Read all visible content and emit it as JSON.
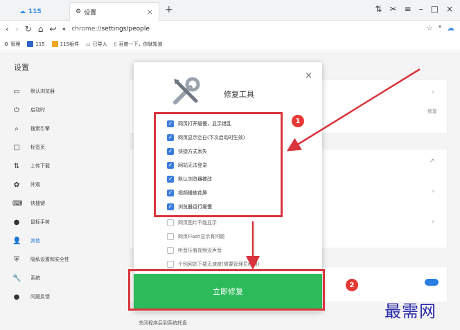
{
  "tabs": [
    {
      "label": "115"
    },
    {
      "label": "设置"
    }
  ],
  "nav": {
    "url_scheme": "chrome://",
    "url_rest": "settings/people"
  },
  "bookmarks": [
    {
      "label": "管理"
    },
    {
      "label": "115"
    },
    {
      "label": "115组件"
    },
    {
      "label": "已导入"
    },
    {
      "label": "百度一下，你就知道"
    }
  ],
  "sidebar": {
    "title": "设置",
    "items": [
      {
        "label": "默认浏览器",
        "icon": "browser-icon"
      },
      {
        "label": "启动时",
        "icon": "power-icon"
      },
      {
        "label": "搜索引擎",
        "icon": "search-icon"
      },
      {
        "label": "标签页",
        "icon": "tab-icon"
      },
      {
        "label": "上传下载",
        "icon": "transfer-icon"
      },
      {
        "label": "外观",
        "icon": "palette-icon"
      },
      {
        "label": "快捷键",
        "icon": "keyboard-icon"
      },
      {
        "label": "鼠标手势",
        "icon": "mouse-icon"
      },
      {
        "label": "其他",
        "icon": "person-icon"
      },
      {
        "label": "隐私设置和安全性",
        "icon": "shield-icon"
      },
      {
        "label": "系统",
        "icon": "wrench-icon"
      },
      {
        "label": "问题反馈",
        "icon": "feedback-icon"
      }
    ]
  },
  "content": {
    "repair_link": "修复",
    "bottom_text": "关闭程序后到系统托盘"
  },
  "dialog": {
    "title": "修复工具",
    "options": [
      {
        "label": "网页打开缓慢，显示错乱",
        "checked": true
      },
      {
        "label": "网页显示空白(下次启动时生效)",
        "checked": true
      },
      {
        "label": "快捷方式丢失",
        "checked": true
      },
      {
        "label": "网站无法登录",
        "checked": true
      },
      {
        "label": "默认浏览器被改",
        "checked": true
      },
      {
        "label": "视频播放花屏",
        "checked": true
      },
      {
        "label": "浏览器运行缓慢",
        "checked": true
      },
      {
        "label": "网页图片不能显示",
        "checked": false
      },
      {
        "label": "网页Flash显示有问题",
        "checked": false
      },
      {
        "label": "听音乐看视频没声音",
        "checked": false
      },
      {
        "label": "个别网站下载无速度(需要管理员权限)",
        "checked": false
      }
    ],
    "fix_button": "立即修复"
  },
  "annotations": {
    "badge1": "1",
    "badge2": "2"
  },
  "watermark": "最需网",
  "colors": {
    "accent": "#2a7de1",
    "fix_button": "#2dba5a",
    "highlight": "#d9343c"
  }
}
